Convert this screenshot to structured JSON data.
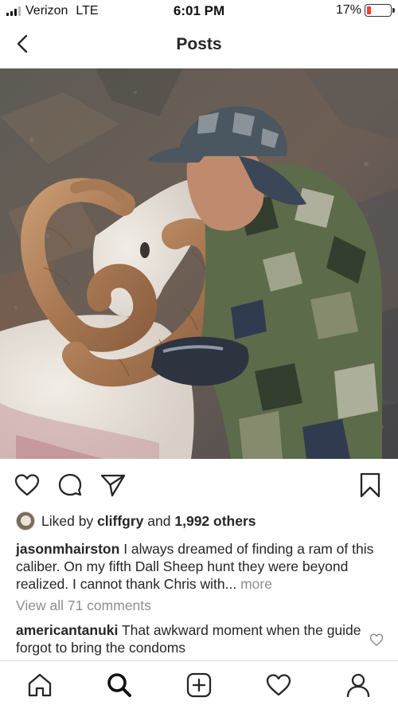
{
  "status_bar": {
    "carrier": "Verizon",
    "network": "LTE",
    "time": "6:01 PM",
    "battery": "17%",
    "battery_level": 0.17
  },
  "nav": {
    "title": "Posts",
    "back_icon": "chevron-left-icon"
  },
  "post": {
    "photo_icon": "photo",
    "actions": {
      "like_icon": "heart-outline-icon",
      "comment_icon": "comment-icon",
      "share_icon": "paper-plane-icon",
      "save_icon": "bookmark-icon"
    },
    "likes": {
      "prefix": "Liked by",
      "user": "cliffgry",
      "joiner": "and",
      "others": "1,992 others"
    },
    "caption": {
      "username": "jasonmhairston",
      "text": "I always dreamed of finding a ram of this caliber. On my fifth Dall Sheep hunt they were beyond realized. I cannot thank Chris with...",
      "more": "more"
    },
    "view_all_comments": "View all 71 comments",
    "comments": [
      {
        "username": "americantanuki",
        "text": "That awkward moment when the guide forgot to bring the condoms"
      }
    ]
  },
  "tab_bar": {
    "items": [
      "home-icon",
      "search-icon",
      "new-post-icon",
      "activity-heart-icon",
      "profile-icon"
    ]
  }
}
